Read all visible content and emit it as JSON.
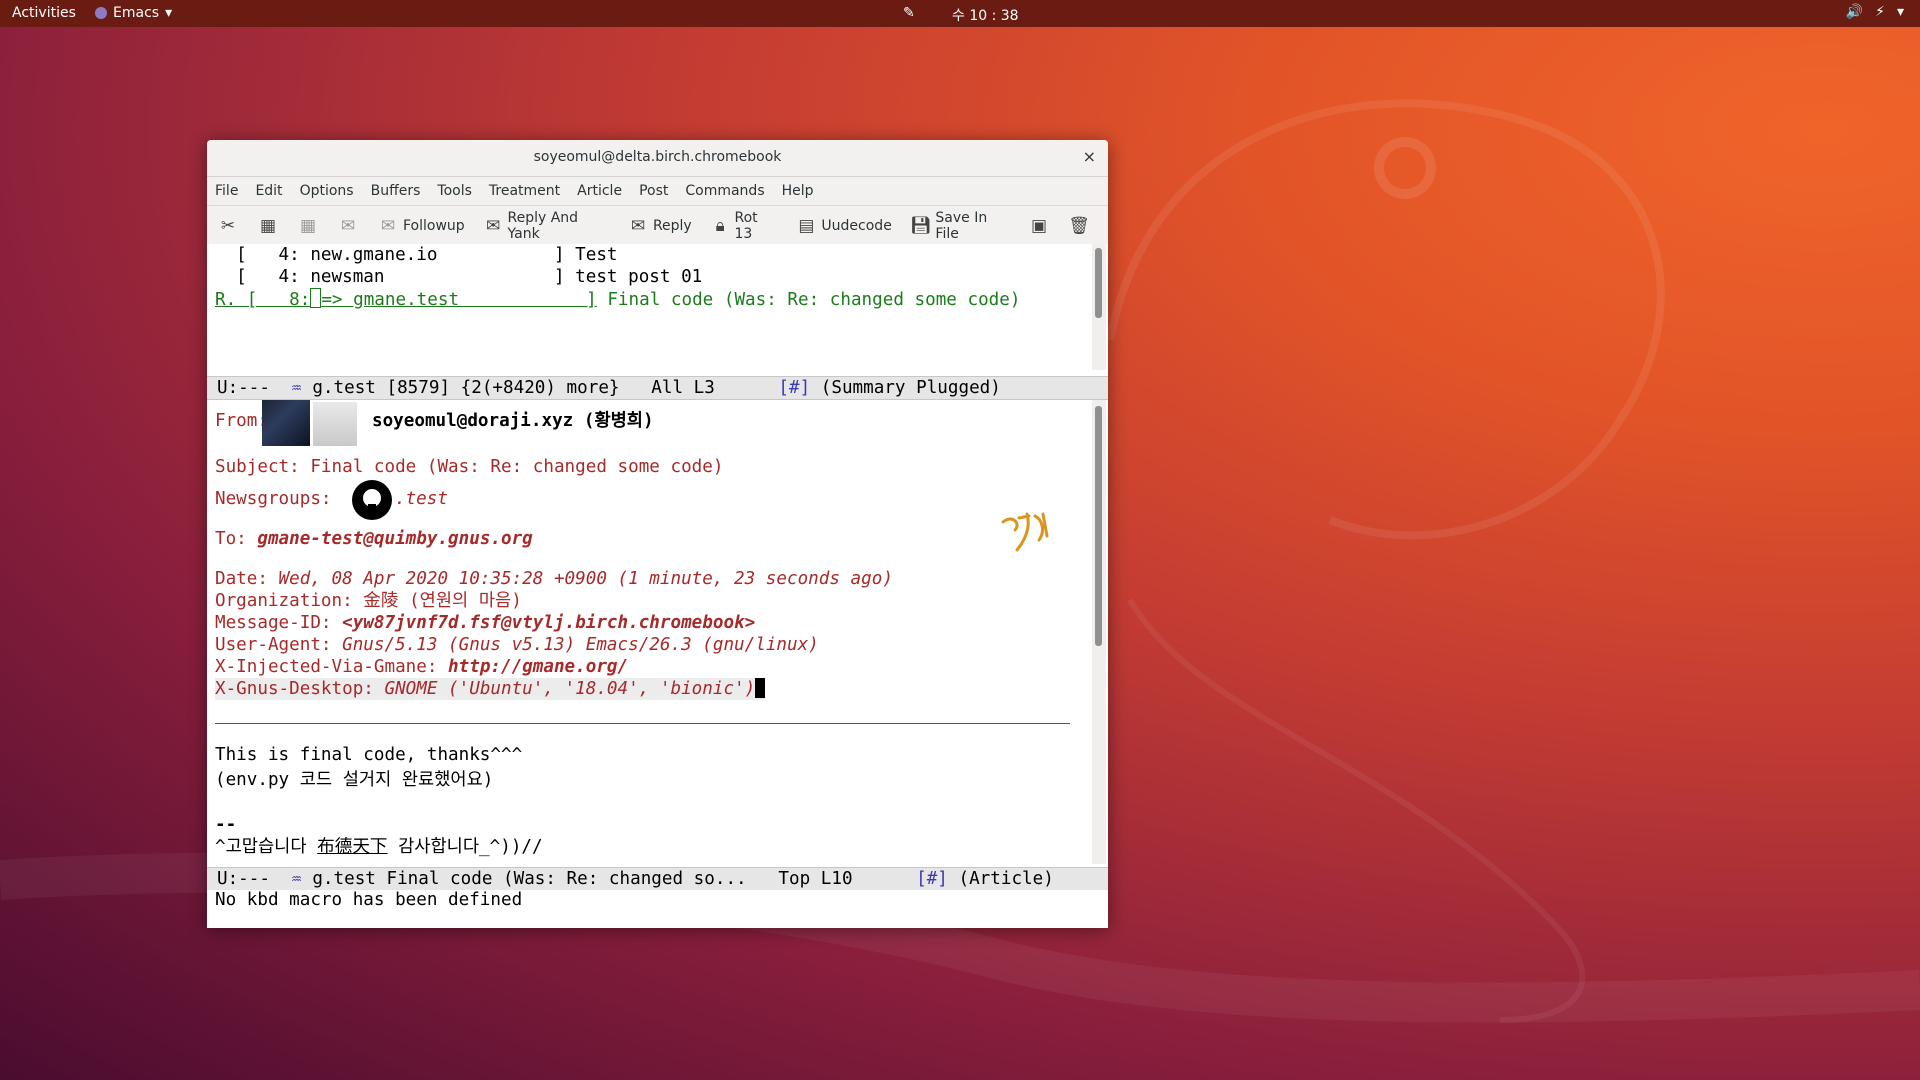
{
  "topbar": {
    "activities": "Activities",
    "app_name": "Emacs",
    "clock": "수 10 : 38"
  },
  "window": {
    "title": "soyeomul@delta.birch.chromebook",
    "close": "×"
  },
  "menu": [
    "File",
    "Edit",
    "Options",
    "Buffers",
    "Tools",
    "Treatment",
    "Article",
    "Post",
    "Commands",
    "Help"
  ],
  "toolbar": {
    "followup": "Followup",
    "reply_and_yank": "Reply And Yank",
    "reply": "Reply",
    "rot13": "Rot 13",
    "uudecode": "Uudecode",
    "save_in_file": "Save In File"
  },
  "summary": {
    "lines": [
      "  [   4: new.gmane.io           ] Test",
      "  [   4: newsman                ] test post 01"
    ],
    "current_prefix": "R. [   8:",
    "current_group": "=> gmane.test            ]",
    "current_subject": " Final code (Was: Re: changed some code)"
  },
  "modeline_summary": {
    "left": "U:---  ",
    "buffer": " g.test [8579] {2(+8420) more}   All L3      ",
    "tag": "[#]",
    "mode": " (Summary Plugged)"
  },
  "article": {
    "from_label": "From:",
    "from_value": "soyeomul@doraji.xyz (황병희)",
    "subject_label": "Subject:",
    "subject_value": " Final code (Was: Re: changed some code)",
    "newsgroups_label": "Newsgroups:",
    "newsgroups_value": ".test",
    "to_label": "To:",
    "to_value": " gmane-test@quimby.gnus.org",
    "date_label": "Date:",
    "date_value": " Wed, 08 Apr 2020 10:35:28 +0900 (1 minute, 23 seconds ago)",
    "org_label": "Organization:",
    "org_value": " 金陵 (연원의 마음)",
    "msgid_label": "Message-ID:",
    "msgid_value": " <yw87jvnf7d.fsf@vtylj.birch.chromebook>",
    "ua_label": "User-Agent:",
    "ua_value": " Gnus/5.13 (Gnus v5.13) Emacs/26.3 (gnu/linux)",
    "xinj_label": "X-Injected-Via-Gmane:",
    "xinj_value": " http://gmane.org/",
    "xgnus_label": "X-Gnus-Desktop:",
    "xgnus_value": " GNOME ('Ubuntu', '18.04', 'bionic')",
    "body1": "This is final code, thanks^^^",
    "body2": "(env.py 코드 설거지 완료했어요)",
    "sig_sep": "--",
    "sig_pre": "^고맙습니다 ",
    "sig_link": "布德天下",
    "sig_post": " 감사합니다_^))//"
  },
  "modeline_article": {
    "left": "U:---  ",
    "buffer": " g.test Final code (Was: Re: changed so...   Top L10      ",
    "tag": "[#]",
    "mode": " (Article)"
  },
  "echo": "No kbd macro has been defined",
  "colors": {
    "header_red": "#a62a2a",
    "summary_green": "#1c7c1c",
    "modeline_tag": "#3a3ab5"
  }
}
